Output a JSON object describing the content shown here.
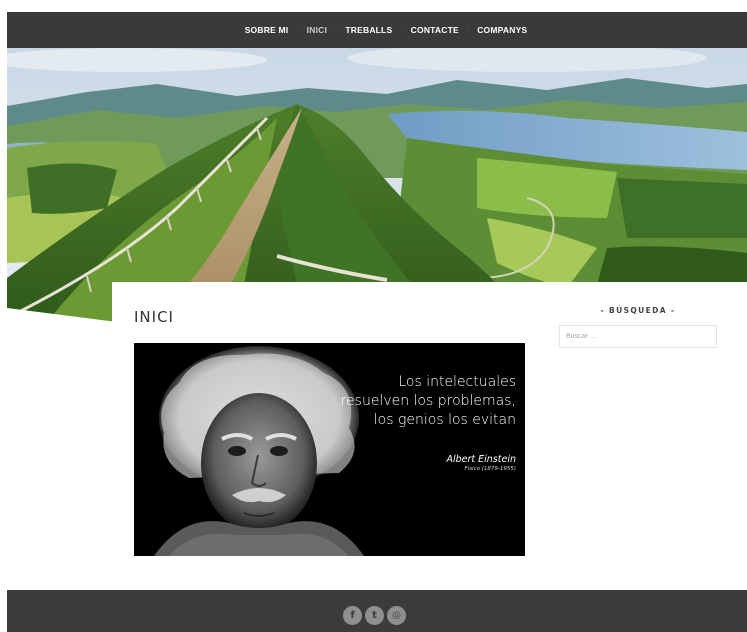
{
  "nav": {
    "items": [
      {
        "label": "SOBRE MI",
        "active": false
      },
      {
        "label": "INICI",
        "active": true
      },
      {
        "label": "TREBALLS",
        "active": false
      },
      {
        "label": "CONTACTE",
        "active": false
      },
      {
        "label": "COMPANYS",
        "active": false
      }
    ],
    "separator": "·"
  },
  "main": {
    "title": "INICI",
    "quote": {
      "text": "Los intelectuales\nresuelven los problemas,\nlos genios los evitan",
      "author": "Albert Einstein",
      "author_subtitle": "Físico (1879-1955)"
    }
  },
  "sidebar": {
    "search_title": "- BÚSQUEDA -",
    "search_placeholder": "Buscar …"
  },
  "footer": {
    "social": [
      {
        "icon": "facebook-icon",
        "glyph": "f"
      },
      {
        "icon": "twitter-icon",
        "glyph": "t"
      },
      {
        "icon": "dribbble-icon",
        "glyph": "◎"
      }
    ]
  },
  "colors": {
    "topbar": "#3a3a3a",
    "footer": "#3b3b3b",
    "social_button": "#8f8f8f"
  }
}
